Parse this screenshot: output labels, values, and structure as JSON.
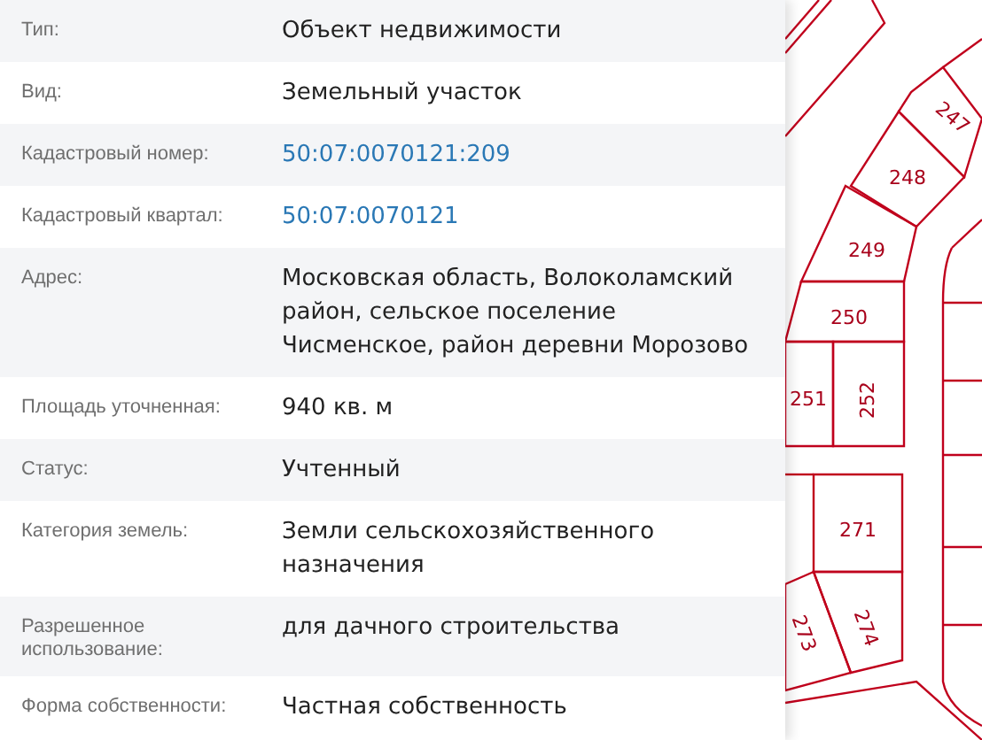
{
  "properties": [
    {
      "label": "Тип:",
      "value": "Объект недвижимости",
      "kind": "text"
    },
    {
      "label": "Вид:",
      "value": "Земельный участок",
      "kind": "text"
    },
    {
      "label": "Кадастровый номер:",
      "value": "50:07:0070121:209",
      "kind": "link"
    },
    {
      "label": "Кадастровый квартал:",
      "value": "50:07:0070121",
      "kind": "link"
    },
    {
      "label": "Адрес:",
      "value": "Московская область, Волоколамский район, сельское поселение Чисменское, район деревни Морозово",
      "kind": "text"
    },
    {
      "label": "Площадь уточненная:",
      "value": "940 кв. м",
      "kind": "text"
    },
    {
      "label": "Статус:",
      "value": "Учтенный",
      "kind": "text"
    },
    {
      "label": "Категория земель:",
      "value": "Земли сельскохозяйственного назначения",
      "kind": "text"
    },
    {
      "label": "Разрешенное использование:",
      "value": "для дачного строительства",
      "kind": "text"
    },
    {
      "label": "Форма собственности:",
      "value": "Частная собственность",
      "kind": "text"
    }
  ],
  "map": {
    "parcels": [
      {
        "label": "247"
      },
      {
        "label": "248"
      },
      {
        "label": "249"
      },
      {
        "label": "250"
      },
      {
        "label": "251"
      },
      {
        "label": "252"
      },
      {
        "label": "271"
      },
      {
        "label": "273"
      },
      {
        "label": "274"
      }
    ]
  }
}
